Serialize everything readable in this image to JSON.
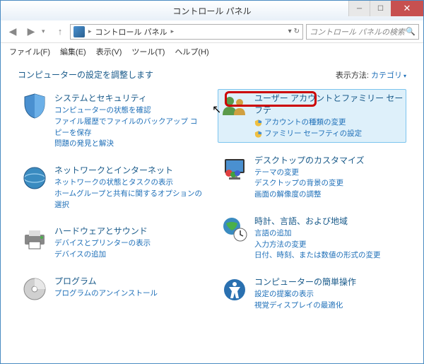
{
  "window": {
    "title": "コントロール パネル"
  },
  "nav": {
    "breadcrumb": "コントロール パネル",
    "search_placeholder": "コントロール パネルの検索"
  },
  "menus": {
    "file": "ファイル(F)",
    "edit": "編集(E)",
    "view": "表示(V)",
    "tools": "ツール(T)",
    "help": "ヘルプ(H)"
  },
  "header": {
    "title": "コンピューターの設定を調整します",
    "viewby_label": "表示方法:",
    "viewby_value": "カテゴリ"
  },
  "cats": {
    "security": {
      "title": "システムとセキュリティ",
      "link1": "コンピューターの状態を確認",
      "link2": "ファイル履歴でファイルのバックアップ コピーを保存",
      "link3": "問題の発見と解決"
    },
    "network": {
      "title": "ネットワークとインターネット",
      "link1": "ネットワークの状態とタスクの表示",
      "link2": "ホームグループと共有に関するオプションの選択"
    },
    "hardware": {
      "title": "ハードウェアとサウンド",
      "link1": "デバイスとプリンターの表示",
      "link2": "デバイスの追加"
    },
    "programs": {
      "title": "プログラム",
      "link1": "プログラムのアンインストール"
    },
    "users": {
      "title": "ユーザー アカウントとファミリー セーフテ",
      "link1": "アカウントの種類の変更",
      "link2": "ファミリー セーフティの設定"
    },
    "appearance": {
      "title": "デスクトップのカスタマイズ",
      "link1": "テーマの変更",
      "link2": "デスクトップの背景の変更",
      "link3": "画面の解像度の調整"
    },
    "clock": {
      "title": "時計、言語、および地域",
      "link1": "言語の追加",
      "link2": "入力方法の変更",
      "link3": "日付、時刻、または数値の形式の変更"
    },
    "ease": {
      "title": "コンピューターの簡単操作",
      "link1": "設定の提案の表示",
      "link2": "視覚ディスプレイの最適化"
    }
  }
}
